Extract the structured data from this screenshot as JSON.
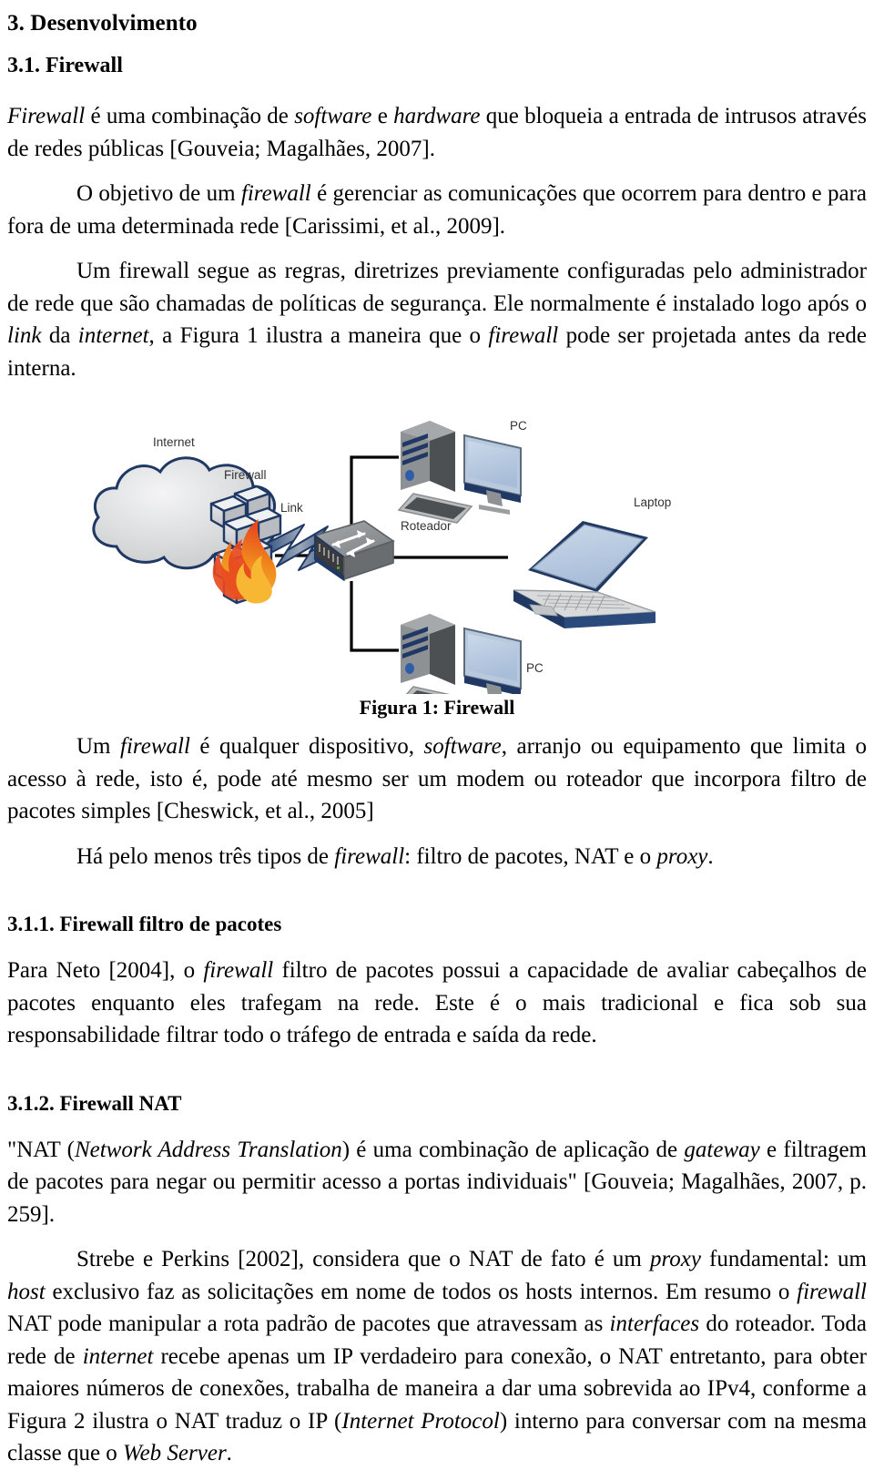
{
  "document": {
    "section_number": "3.",
    "section_title": "Desenvolvimento",
    "subsection_number": "3.1.",
    "subsection_title": "Firewall"
  },
  "headings": {
    "h1": "3.  Desenvolvimento",
    "h2": "3.1. Firewall",
    "h3_packet_filter": "3.1.1. Firewall filtro de pacotes",
    "h3_nat": "3.1.2. Firewall NAT"
  },
  "paragraphs": {
    "p1": {
      "run1_italic": "Firewall",
      "run2": " é uma combinação de ",
      "run3_italic": "software",
      "run4": " e ",
      "run5_italic": "hardware",
      "run6": " que bloqueia a entrada de intrusos através de redes públicas [Gouveia; Magalhães, 2007]."
    },
    "p2": {
      "run1": "O objetivo de um ",
      "run2_italic": "firewall",
      "run3": " é gerenciar as comunicações que ocorrem para dentro e para fora de uma determinada rede [Carissimi, et al., 2009]."
    },
    "p3": {
      "run1": "Um firewall segue as regras, diretrizes previamente configuradas pelo administrador de rede que são chamadas de políticas de segurança. Ele normalmente é instalado logo após o ",
      "run2_italic": "link",
      "run3": " da ",
      "run4_italic": "internet",
      "run5": ", a Figura 1 ilustra a maneira que o ",
      "run6_italic": "firewall",
      "run7": " pode ser projetada antes da rede interna."
    },
    "p4": {
      "run1": "Um ",
      "run2_italic": "firewall",
      "run3": " é qualquer dispositivo, ",
      "run4_italic": "software",
      "run5": ", arranjo ou equipamento que limita o acesso à rede, isto é, pode até mesmo ser um modem ou roteador que incorpora filtro de pacotes simples [Cheswick, et al., 2005]"
    },
    "p5": {
      "run1": "Há pelo menos três tipos de ",
      "run2_italic": "firewall",
      "run3": ": filtro de pacotes, NAT e o ",
      "run4_italic": "proxy",
      "run5": "."
    },
    "p6": {
      "run1": "Para Neto [2004], o ",
      "run2_italic": "firewall",
      "run3": " filtro de pacotes possui a capacidade de avaliar cabeçalhos de pacotes enquanto eles trafegam na rede. Este é o mais tradicional e fica sob sua responsabilidade filtrar todo o tráfego de entrada e saída da rede."
    },
    "p7": {
      "run1": "\"NAT (",
      "run2_italic": "Network Address Translation",
      "run3": ") é uma combinação de aplicação de ",
      "run4_italic": "gateway",
      "run5": " e filtragem de pacotes para negar ou permitir acesso a portas individuais\" [Gouveia; Magalhães, 2007, p. 259]."
    },
    "p8": {
      "run1": "Strebe e Perkins [2002], considera que o NAT de fato é um ",
      "run2_italic": "proxy",
      "run3": " fundamental: um ",
      "run4_italic": "host",
      "run5": " exclusivo faz as solicitações em nome de todos os hosts internos. Em resumo o ",
      "run6_italic": "firewall",
      "run7": " NAT pode manipular a rota padrão de pacotes que atravessam as ",
      "run8_italic": "interfaces",
      "run9": " do roteador. Toda rede de ",
      "run10_italic": "internet",
      "run11": " recebe apenas um IP verdadeiro para conexão, o NAT entretanto, para obter maiores números de conexões, trabalha de maneira a dar uma sobrevida ao IPv4, conforme a Figura 2 ilustra o NAT traduz o IP (",
      "run12_italic": "Internet Protocol",
      "run13": ") interno para conversar com na mesma classe que o ",
      "run14_italic": "Web Server",
      "run15": "."
    }
  },
  "figure": {
    "caption": "Figura 1: Firewall",
    "labels": {
      "internet": "Internet",
      "link": "Link",
      "firewall": "Firewall",
      "router": "Roteador",
      "pc_top": "PC",
      "pc_bottom": "PC",
      "laptop": "Laptop"
    },
    "colors": {
      "outline_blue": "#1f3864",
      "cloud_fill": "#d9d9d9",
      "screen_blue": "#b9cce4",
      "tower_gray": "#7f7f7f",
      "tower_dark": "#4d4d4d",
      "flame_orange": "#f5a623",
      "flame_red": "#e8491e",
      "brick_gray": "#d0d2d4",
      "wire_black": "#000000",
      "label_gray": "#333333",
      "router_body": "#8a8d90",
      "router_dark": "#3b3b3b",
      "router_trim": "#1f3864"
    }
  }
}
